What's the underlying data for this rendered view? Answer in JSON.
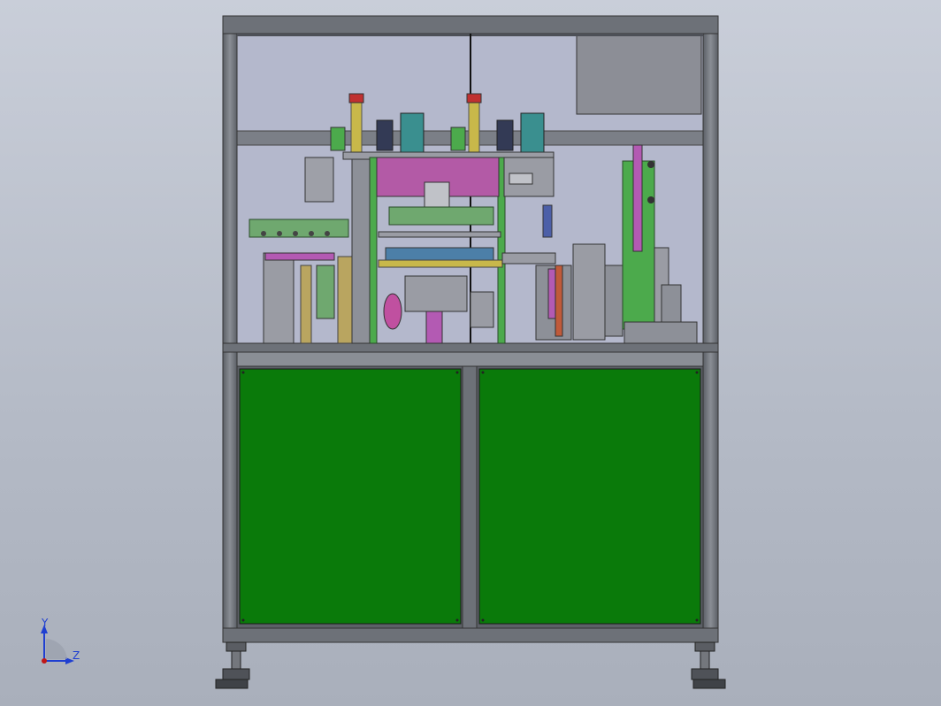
{
  "view": {
    "type": "cad-assembly-front-view",
    "background_color": "#b8beca"
  },
  "machine": {
    "frame_color": "#6d7178",
    "lower_panel_color": "#0a7a0a",
    "upper_enclosure_color": "#b4b8cc",
    "door_panels": [
      "left-door",
      "right-door"
    ]
  },
  "triad": {
    "y_label": "Y",
    "z_label": "Z",
    "y_color": "#1f3fd1",
    "z_color": "#1f3fd1",
    "origin_color": "#c01818"
  }
}
